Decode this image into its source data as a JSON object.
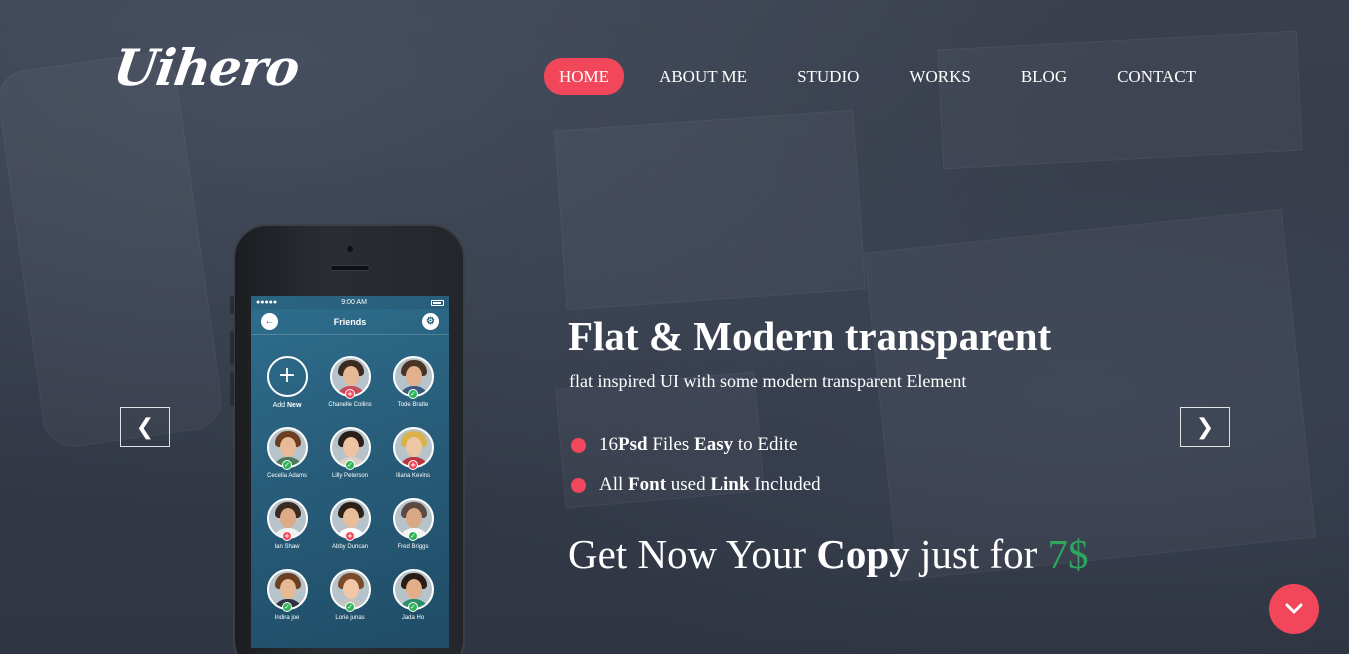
{
  "brand": {
    "logo_text": "Uihero"
  },
  "nav": {
    "items": [
      {
        "label": "HOME",
        "active": true
      },
      {
        "label": "ABOUT ME",
        "active": false
      },
      {
        "label": "STUDIO",
        "active": false
      },
      {
        "label": "WORKS",
        "active": false
      },
      {
        "label": "BLOG",
        "active": false
      },
      {
        "label": "CONTACT",
        "active": false
      }
    ]
  },
  "slider": {
    "prev_icon": "chevron-left-icon",
    "next_icon": "chevron-right-icon",
    "prev_glyph": "❮",
    "next_glyph": "❯"
  },
  "phone": {
    "status_signal": "●●●●● ",
    "status_time": "9:00 AM",
    "app_title": "Friends",
    "add_label_prefix": "Add ",
    "add_label_bold": "New",
    "friends": [
      {
        "name": "Chanelle Collins",
        "status": "offline"
      },
      {
        "name": "Tode Bratte",
        "status": "online"
      },
      {
        "name": "Cecelia Adams",
        "status": "online"
      },
      {
        "name": "Lilly Peterson",
        "status": "online"
      },
      {
        "name": "Iliana Kevins",
        "status": "offline"
      },
      {
        "name": "Ian Shaw",
        "status": "offline"
      },
      {
        "name": "Abby Duncan",
        "status": "offline"
      },
      {
        "name": "Fred Briggs",
        "status": "online"
      },
      {
        "name": "Indira joe",
        "status": "online"
      },
      {
        "name": "Lorie junas",
        "status": "online"
      },
      {
        "name": "Jada Ho",
        "status": "online"
      }
    ]
  },
  "hero": {
    "title": "Flat & Modern transparent",
    "subtitle": "flat inspired UI with some modern transparent Element",
    "feature1": {
      "a": "16",
      "b": "Psd",
      "c": " Files ",
      "d": "Easy",
      "e": " to Edite"
    },
    "feature2": {
      "a": "All ",
      "b": "Font",
      "c": " used ",
      "d": "Link",
      "e": " Included"
    },
    "cta": {
      "a": "Get Now Your ",
      "b": "Copy",
      "c": " just for ",
      "price": "7$"
    }
  },
  "colors": {
    "accent": "#f2475a",
    "price": "#2fa560",
    "online": "#2fb45a",
    "background": "#343a47"
  },
  "scroll_button": {
    "icon": "chevron-down-icon"
  }
}
